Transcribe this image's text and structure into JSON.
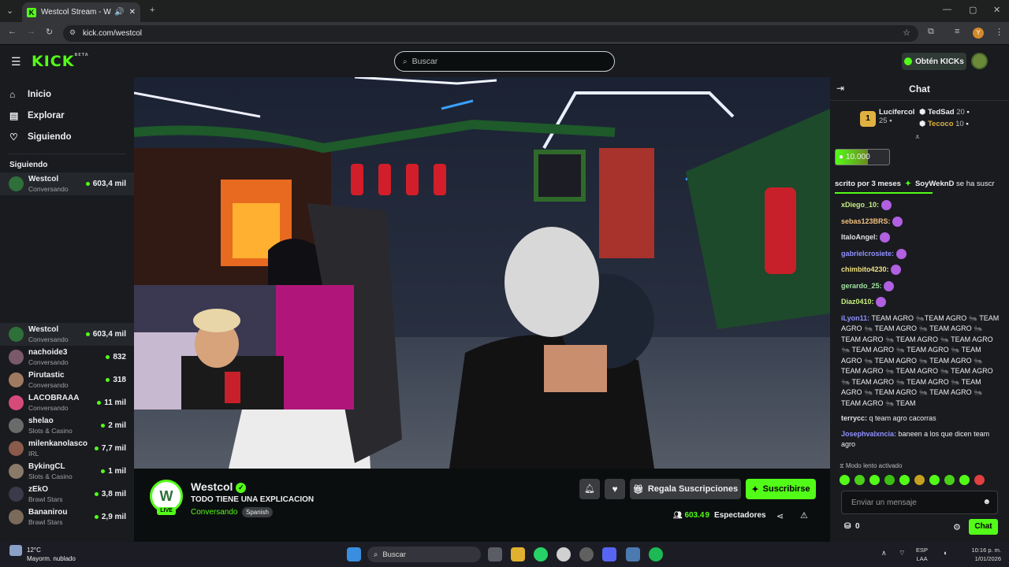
{
  "browser": {
    "tab_title": "Westcol Stream - Watch Li",
    "url": "kick.com/westcol"
  },
  "header": {
    "logo": "KICK",
    "logo_badge": "BETA",
    "search_placeholder": "Buscar",
    "get_kicks": "Obtén KICKs"
  },
  "nav": {
    "items": [
      {
        "label": "Inicio",
        "icon": "home-icon"
      },
      {
        "label": "Explorar",
        "icon": "explore-icon"
      },
      {
        "label": "Siguiendo",
        "icon": "heart-icon"
      }
    ],
    "following_title": "Siguiendo"
  },
  "following": [
    {
      "name": "Westcol",
      "category": "Conversando",
      "viewers": "603,4 mil",
      "color": "#2f6f3a"
    }
  ],
  "recommended": [
    {
      "name": "Westcol",
      "category": "Conversando",
      "viewers": "603,4 mil",
      "color": "#2f6f3a"
    },
    {
      "name": "nachoide3",
      "category": "Conversando",
      "viewers": "832",
      "color": "#7a5a6a"
    },
    {
      "name": "Pirutastic",
      "category": "Conversando",
      "viewers": "318",
      "color": "#a07a60"
    },
    {
      "name": "LACOBRAAA",
      "category": "Conversando",
      "viewers": "11 mil",
      "color": "#d64a7a"
    },
    {
      "name": "shelao",
      "category": "Slots & Casino",
      "viewers": "2 mil",
      "color": "#6a6a6a"
    },
    {
      "name": "milenkanolasco",
      "category": "IRL",
      "viewers": "7,7 mil",
      "color": "#8a5a4a"
    },
    {
      "name": "BykingCL",
      "category": "Slots & Casino",
      "viewers": "1 mil",
      "color": "#8a7a6a"
    },
    {
      "name": "zEkO",
      "category": "Brawl Stars",
      "viewers": "3,8 mil",
      "color": "#3a3a4a"
    },
    {
      "name": "Bananirou",
      "category": "Brawl Stars",
      "viewers": "2,9 mil",
      "color": "#7a6a5a"
    }
  ],
  "stream": {
    "channel": "Westcol",
    "title": "TODO TIENE UNA EXPLICACION",
    "category": "Conversando",
    "language": "Spanish",
    "live_badge": "LIVE",
    "viewers": "603.4",
    "viewers_tail": "9",
    "viewers_label": "Espectadores",
    "gift_subs": "Regala Suscripciones",
    "subscribe": "Suscribirse",
    "chaptcha_logo": "W"
  },
  "chat": {
    "title": "Chat",
    "top_gifters": [
      {
        "name": "Lucifercol",
        "count": "25",
        "rank": "1"
      },
      {
        "name": "TedSad",
        "count": "20"
      },
      {
        "name": "Tecoco",
        "count": "10"
      }
    ],
    "kicks_goal": "10.000",
    "ticker": "scrito por 3 meses",
    "ticker_user": "SoyWeknD",
    "ticker_tail": "se ha suscr",
    "messages": [
      {
        "user": "xDiego_10:",
        "color": "#c8f080",
        "text": ""
      },
      {
        "user": "sebas123BRS:",
        "color": "#f0c080",
        "text": ""
      },
      {
        "user": "ItaloAngel:",
        "color": "#e0e0e0",
        "text": ""
      },
      {
        "user": "gabrielcrosiete:",
        "color": "#9090ff",
        "text": ""
      },
      {
        "user": "chimbito4230:",
        "color": "#f0e080",
        "text": ""
      },
      {
        "user": "gerardo_25:",
        "color": "#a0e0a0",
        "text": ""
      },
      {
        "user": "Diaz0410:",
        "color": "#c8f080",
        "text": ""
      },
      {
        "user": "iLyon11:",
        "color": "#9090ff",
        "text": "TEAM AGRO 🐜TEAM AGRO 🐜 TEAM AGRO 🐜 TEAM AGRO 🐜 TEAM AGRO 🐜 TEAM AGRO 🐜 TEAM AGRO 🐜 TEAM AGRO 🐜 TEAM AGRO 🐜 TEAM AGRO 🐜 TEAM AGRO 🐜 TEAM AGRO 🐜 TEAM AGRO 🐜 TEAM AGRO 🐜 TEAM AGRO 🐜 TEAM AGRO 🐜 TEAM AGRO 🐜 TEAM AGRO 🐜 TEAM AGRO 🐜 TEAM AGRO 🐜 TEAM AGRO 🐜 TEAM AGRO 🐜 TEAM"
      },
      {
        "user": "terrycc:",
        "color": "#e0e0e0",
        "text": "q team agro cacorras"
      },
      {
        "user": "Josephvalxncia:",
        "color": "#9090ff",
        "text": "baneen a los que dicen team agro"
      }
    ],
    "slow_mode": "Modo lento activado",
    "input_placeholder": "Enviar un mensaje",
    "points": "0",
    "send": "Chat"
  },
  "taskbar": {
    "weather_temp": "12°C",
    "weather_desc": "Mayorm. nublado",
    "search": "Buscar",
    "lang": "ESP",
    "lang2": "LAA",
    "time": "10:16 p. m.",
    "date": "1/01/2026"
  }
}
